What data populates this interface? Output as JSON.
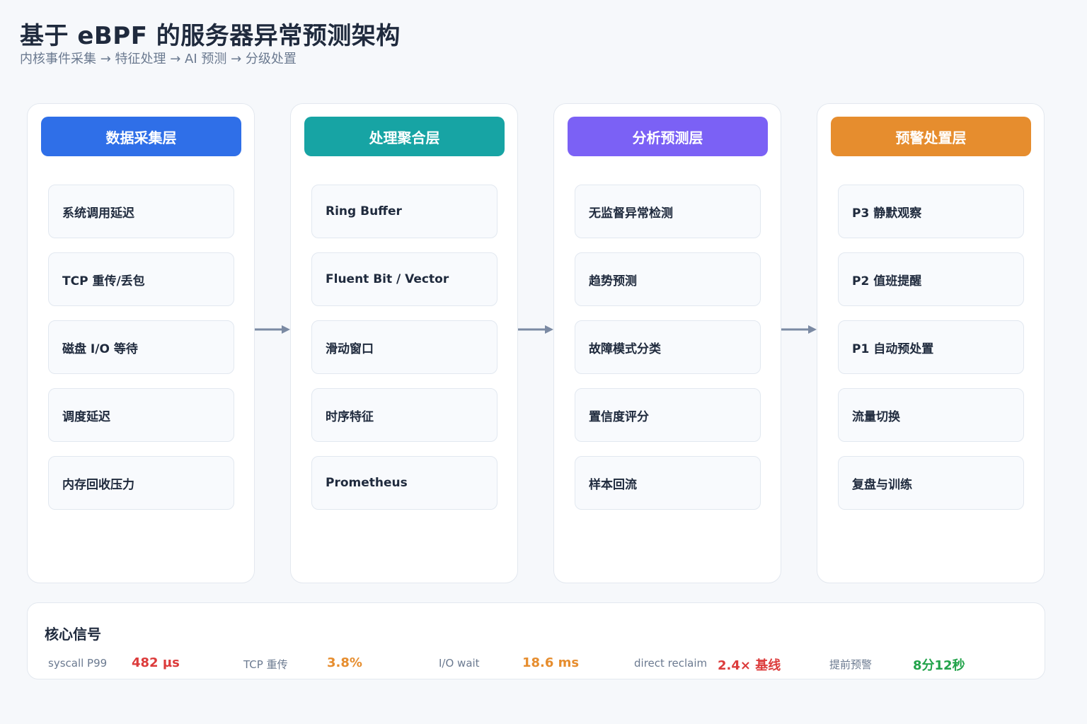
{
  "title": "基于 eBPF 的服务器异常预测架构",
  "subtitle": "内核事件采集 → 特征处理 → AI 预测 → 分级处置",
  "columns": [
    {
      "header": "数据采集层",
      "color": "#2f6fe8",
      "items": [
        "系统调用延迟",
        "TCP 重传/丢包",
        "磁盘 I/O 等待",
        "调度延迟",
        "内存回收压力"
      ]
    },
    {
      "header": "处理聚合层",
      "color": "#17a4a4",
      "items": [
        "Ring Buffer",
        "Fluent Bit / Vector",
        "滑动窗口",
        "时序特征",
        "Prometheus"
      ]
    },
    {
      "header": "分析预测层",
      "color": "#7b61f5",
      "items": [
        "无监督异常检测",
        "趋势预测",
        "故障模式分类",
        "置信度评分",
        "样本回流"
      ]
    },
    {
      "header": "预警处置层",
      "color": "#e68d2e",
      "items": [
        "P3 静默观察",
        "P2 值班提醒",
        "P1 自动预处置",
        "流量切换",
        "复盘与训练"
      ]
    }
  ],
  "signals": {
    "title": "核心信号",
    "metrics": [
      {
        "label": "syscall P99",
        "value": "482 µs",
        "color": "#dc3b3b"
      },
      {
        "label": "TCP 重传",
        "value": "3.8%",
        "color": "#e68d2e"
      },
      {
        "label": "I/O wait",
        "value": "18.6 ms",
        "color": "#e68d2e"
      },
      {
        "label": "direct reclaim",
        "value": "2.4× 基线",
        "color": "#dc3b3b"
      },
      {
        "label": "提前预警",
        "value": "8分12秒",
        "color": "#22a34a"
      }
    ]
  },
  "arrow_color": "#7b8aa3"
}
